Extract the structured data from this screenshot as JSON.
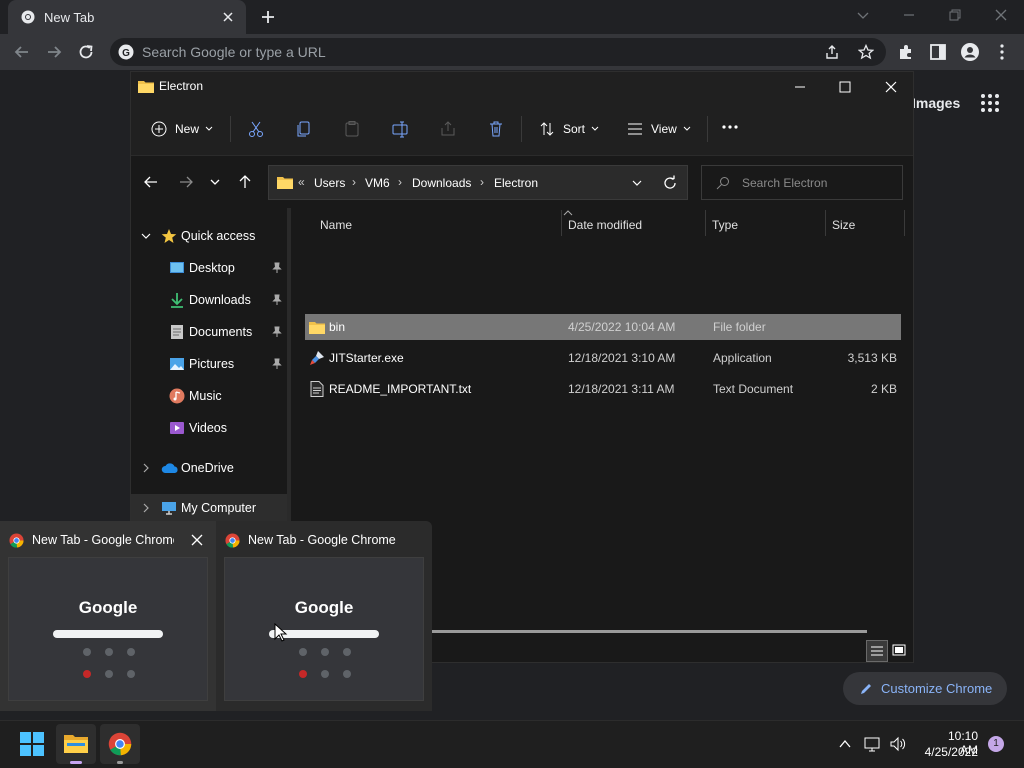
{
  "chrome": {
    "tab_title": "New Tab",
    "omnibox_placeholder": "Search Google or type a URL",
    "images_link": "Images",
    "customize_label": "Customize Chrome"
  },
  "explorer": {
    "window_title": "Electron",
    "commands": {
      "new": "New",
      "sort": "Sort",
      "view": "View"
    },
    "breadcrumbs": [
      "Users",
      "VM6",
      "Downloads",
      "Electron"
    ],
    "search_placeholder": "Search Electron",
    "nav": {
      "quick_access": "Quick access",
      "items": [
        {
          "label": "Desktop",
          "pinned": true
        },
        {
          "label": "Downloads",
          "pinned": true
        },
        {
          "label": "Documents",
          "pinned": true
        },
        {
          "label": "Pictures",
          "pinned": true
        },
        {
          "label": "Music",
          "pinned": false
        },
        {
          "label": "Videos",
          "pinned": false
        }
      ],
      "onedrive": "OneDrive",
      "my_computer": "My Computer"
    },
    "columns": [
      "Name",
      "Date modified",
      "Type",
      "Size"
    ],
    "files": [
      {
        "name": "bin",
        "date": "4/25/2022 10:04 AM",
        "type": "File folder",
        "size": "",
        "selected": true,
        "icon": "folder-icon"
      },
      {
        "name": "JITStarter.exe",
        "date": "12/18/2021 3:10 AM",
        "type": "Application",
        "size": "3,513 KB",
        "selected": false,
        "icon": "app-icon"
      },
      {
        "name": "README_IMPORTANT.txt",
        "date": "12/18/2021 3:11 AM",
        "type": "Text Document",
        "size": "2 KB",
        "selected": false,
        "icon": "text-file-icon"
      }
    ]
  },
  "previews": [
    {
      "title": "New Tab - Google Chrome",
      "thumb_logo": "Google"
    },
    {
      "title": "New Tab - Google Chrome",
      "thumb_logo": "Google"
    }
  ],
  "taskbar": {
    "time": "10:10 AM",
    "date": "4/25/2022",
    "notification_count": "1"
  }
}
